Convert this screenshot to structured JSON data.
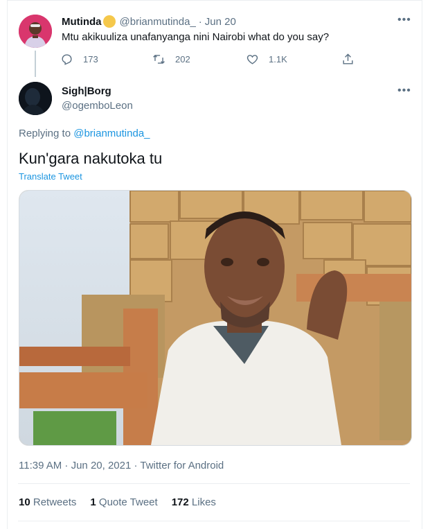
{
  "parent_tweet": {
    "display_name": "Mutinda",
    "handle": "@brianmutinda_",
    "separator": "·",
    "date": "Jun 20",
    "text": "Mtu akikuuliza unafanyanga nini Nairobi what do you say?",
    "replies": "173",
    "retweets": "202",
    "likes": "1.1K"
  },
  "main_tweet": {
    "display_name": "Sigh|Borg",
    "handle": "@ogemboLeon",
    "replying_prefix": "Replying to",
    "replying_to": "@brianmutinda_",
    "text": "Kun'gara nakutoka tu",
    "translate_label": "Translate Tweet",
    "timestamp": "11:39 AM · Jun 20, 2021 · Twitter for Android"
  },
  "stats": {
    "retweets_count": "10",
    "retweets_label": "Retweets",
    "quotes_count": "1",
    "quotes_label": "Quote Tweet",
    "likes_count": "172",
    "likes_label": "Likes"
  },
  "icons": {
    "more": "more-icon",
    "reply": "reply-icon",
    "retweet": "retweet-icon",
    "like": "heart-icon",
    "share": "share-icon",
    "verified": "verified-badge-icon"
  },
  "colors": {
    "accent": "#1b95e0",
    "muted": "#5b7083",
    "text": "#0f1419",
    "verified_badge": "#f5c84b"
  }
}
